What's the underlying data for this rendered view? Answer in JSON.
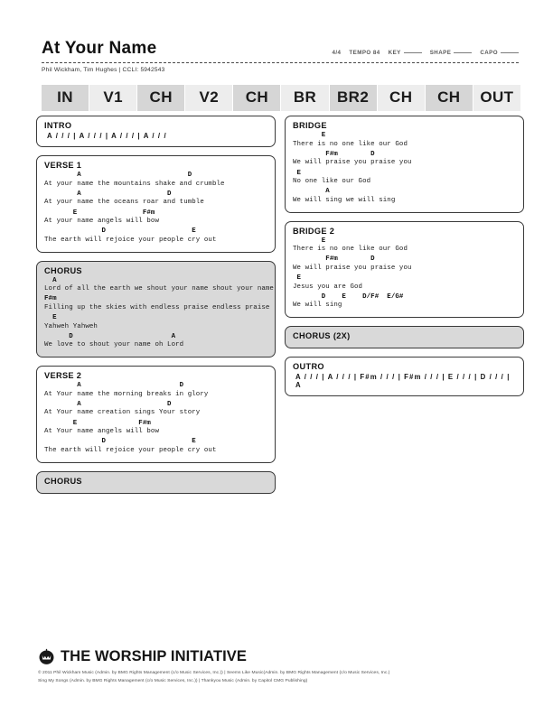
{
  "header": {
    "title": "At Your Name",
    "time_signature": "4/4",
    "tempo_label": "TEMPO",
    "tempo_value": "84",
    "key_label": "KEY",
    "shape_label": "SHAPE",
    "capo_label": "CAPO",
    "credits": "Phil Wickham, Tim Hughes | CCLI: 5942543"
  },
  "nav": {
    "items": [
      {
        "label": "IN",
        "shade": "dark"
      },
      {
        "label": "V1",
        "shade": "light"
      },
      {
        "label": "CH",
        "shade": "dark"
      },
      {
        "label": "V2",
        "shade": "light"
      },
      {
        "label": "CH",
        "shade": "dark"
      },
      {
        "label": "BR",
        "shade": "light"
      },
      {
        "label": "BR2",
        "shade": "dark"
      },
      {
        "label": "CH",
        "shade": "light"
      },
      {
        "label": "CH",
        "shade": "dark"
      },
      {
        "label": "OUT",
        "shade": "light"
      }
    ]
  },
  "left_column": [
    {
      "id": "intro",
      "title": "INTRO",
      "shaded": false,
      "progression": "A / / / | A / / / | A / / / | A / / /",
      "lines": []
    },
    {
      "id": "verse-1",
      "title": "VERSE 1",
      "shaded": false,
      "lines": [
        {
          "chords": "        A                          D",
          "text": "At your name the mountains shake and crumble"
        },
        {
          "chords": "        A                     D",
          "text": "At your name the oceans roar and tumble"
        },
        {
          "chords": "       E                F#m",
          "text": "At your name angels will bow"
        },
        {
          "chords": "              D                     E",
          "text": "The earth will rejoice your people cry out"
        }
      ]
    },
    {
      "id": "chorus",
      "title": "CHORUS",
      "shaded": true,
      "lines": [
        {
          "chords": "  A",
          "text": "Lord of all the earth we shout your name shout your name"
        },
        {
          "chords": "F#m",
          "text": "Filling up the skies with endless praise endless praise"
        },
        {
          "chords": "  E",
          "text": "Yahweh Yahweh"
        },
        {
          "chords": "      D                        A",
          "text": "We love to shout your name oh Lord"
        }
      ]
    },
    {
      "id": "verse-2",
      "title": "VERSE 2",
      "shaded": false,
      "lines": [
        {
          "chords": "        A                        D",
          "text": "At Your name the morning breaks in glory"
        },
        {
          "chords": "        A                     D",
          "text": "At Your name creation sings Your story"
        },
        {
          "chords": "       E               F#m",
          "text": "At Your name angels will bow"
        },
        {
          "chords": "              D                     E",
          "text": "The earth will rejoice your people cry out"
        }
      ]
    },
    {
      "id": "chorus-ref",
      "title": "CHORUS",
      "shaded": true,
      "lines": []
    }
  ],
  "right_column": [
    {
      "id": "bridge",
      "title": "BRIDGE",
      "shaded": false,
      "lines": [
        {
          "chords": "       E",
          "text": "There is no one like our God"
        },
        {
          "chords": "        F#m        D",
          "text": "We will praise you praise you"
        },
        {
          "chords": " E",
          "text": "No one like our God"
        },
        {
          "chords": "        A",
          "text": "We will sing we will sing"
        }
      ]
    },
    {
      "id": "bridge-2",
      "title": "BRIDGE 2",
      "shaded": false,
      "lines": [
        {
          "chords": "       E",
          "text": "There is no one like our God"
        },
        {
          "chords": "        F#m        D",
          "text": "We will praise you praise you"
        },
        {
          "chords": " E",
          "text": "Jesus you are God"
        },
        {
          "chords": "       D    E    D/F#  E/G#",
          "text": "We will sing"
        }
      ]
    },
    {
      "id": "chorus-2x",
      "title": "CHORUS (2X)",
      "shaded": true,
      "lines": []
    },
    {
      "id": "outro",
      "title": "OUTRO",
      "shaded": false,
      "progression": "A / / / | A / / / | F#m / / / | F#m / / / | E / / / | D / / / | A",
      "lines": []
    }
  ],
  "footer": {
    "brand": "THE WORSHIP INITIATIVE",
    "logo_icon": "crown-circle-icon",
    "copyright_line_1": "© 2011 Phil Wickham Music (Admin. by BMG Rights Management (c/o Music Services, Inc.)) | Seems Like Music(Admin. by BMG Rights Management (c/o Music Services, Inc.)",
    "copyright_line_2": "Sing My Songs (Admin. by BMG Rights Management (c/o Music Services, Inc.)) | Thankyou Music (Admin. by Capitol CMG Publishing)"
  }
}
